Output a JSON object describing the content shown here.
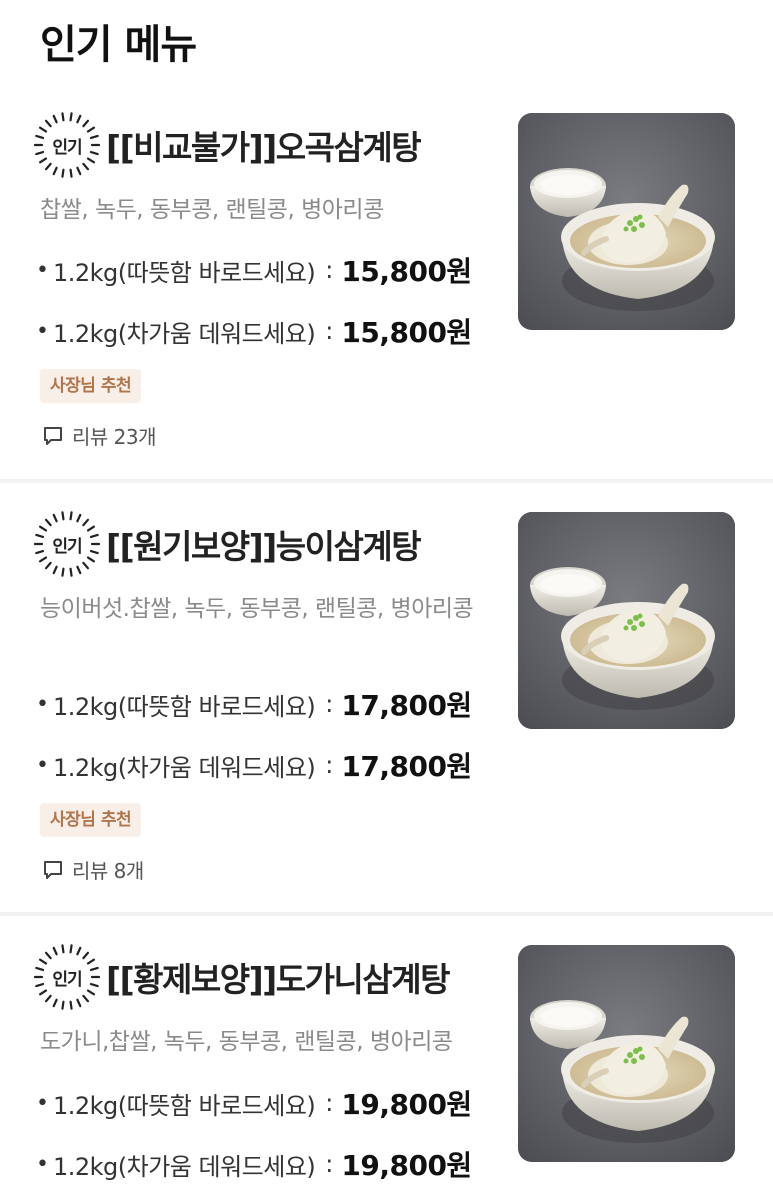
{
  "section_title": "인기 메뉴",
  "badge_label": "인기",
  "tag_label": "사장님 추천",
  "colors": {
    "tag_bg": "#f7efe8",
    "tag_text": "#b2754b",
    "desc": "#8a8a8a",
    "price": "#111111"
  },
  "items": [
    {
      "name": "[[비교불가]]오곡삼계탕",
      "description": "찹쌀, 녹두, 동부콩, 랜틸콩, 병아리콩",
      "options": [
        {
          "bullet": "•",
          "name": "1.2kg(따뜻함 바로드세요)",
          "sep": ":",
          "price": "15,800원"
        },
        {
          "bullet": "•",
          "name": "1.2kg(차가움 데워드세요)",
          "sep": ":",
          "price": "15,800원"
        }
      ],
      "review_label": "리뷰 23개",
      "image_icon": "samgyetang-bowl-image"
    },
    {
      "name": "[[원기보양]]능이삼계탕",
      "description": "능이버섯.찹쌀, 녹두, 동부콩, 랜틸콩, 병아리콩",
      "options": [
        {
          "bullet": "•",
          "name": "1.2kg(따뜻함 바로드세요)",
          "sep": ":",
          "price": "17,800원"
        },
        {
          "bullet": "•",
          "name": "1.2kg(차가움 데워드세요)",
          "sep": ":",
          "price": "17,800원"
        }
      ],
      "review_label": "리뷰 8개",
      "image_icon": "samgyetang-bowl-image"
    },
    {
      "name": "[[황제보양]]도가니삼계탕",
      "description": "도가니,찹쌀, 녹두, 동부콩, 랜틸콩, 병아리콩",
      "options": [
        {
          "bullet": "•",
          "name": "1.2kg(따뜻함 바로드세요)",
          "sep": ":",
          "price": "19,800원"
        },
        {
          "bullet": "•",
          "name": "1.2kg(차가움 데워드세요)",
          "sep": ":",
          "price": "19,800원"
        }
      ],
      "image_icon": "samgyetang-bowl-image"
    }
  ]
}
